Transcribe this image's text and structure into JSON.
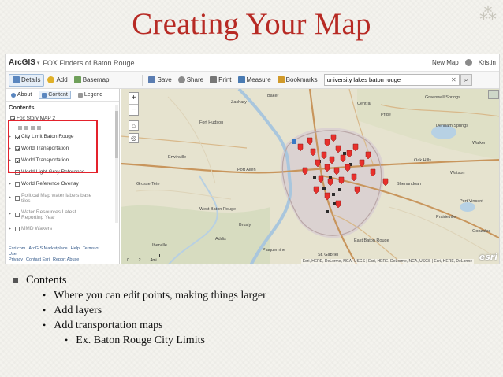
{
  "slide": {
    "title": "Creating Your Map",
    "ornament": "⁂"
  },
  "app": {
    "logo": "ArcGIS",
    "logo_caret": "▾",
    "title": "FOX Finders of Baton Rouge",
    "new_map": "New Map",
    "user": "Kristin"
  },
  "toolbar": {
    "details": "Details",
    "add": "Add",
    "basemap": "Basemap",
    "save": "Save",
    "share": "Share",
    "print": "Print",
    "measure": "Measure",
    "bookmarks": "Bookmarks",
    "search_value": "university lakes baton rouge",
    "clear": "✕",
    "search_icon": "⌕"
  },
  "sidebar": {
    "tabs": [
      {
        "label": "About"
      },
      {
        "label": "Content"
      },
      {
        "label": "Legend"
      }
    ],
    "contents_heading": "Contents",
    "layers": [
      {
        "label": "Fox Story MAP 2",
        "checked": true
      },
      {
        "label": "City Limit Baton Rouge",
        "checked": true
      },
      {
        "label": "World Transportation",
        "checked": true
      },
      {
        "label": "World Transportation",
        "checked": true
      },
      {
        "label": "World Light Gray Reference",
        "checked": false
      },
      {
        "label": "World Reference Overlay",
        "checked": false
      },
      {
        "label": "Political Map water labels base tiles",
        "checked": false
      },
      {
        "label": "Water Resources Latest Reporting Year",
        "checked": false
      },
      {
        "label": "MMD Wakers",
        "checked": false
      }
    ],
    "footer_links": [
      "Esri.com",
      "ArcGIS Marketplace",
      "Help",
      "Terms of Use",
      "Privacy",
      "Contact Esri",
      "Report Abuse"
    ]
  },
  "map": {
    "labels": {
      "zachary": "Zachary",
      "central": "Central",
      "denham": "Denham Springs",
      "walker": "Walker",
      "port_allen": "Port Allen",
      "brusly": "Brusly",
      "plaquemine": "Plaquemine",
      "gonzales": "Gonzales",
      "prairieville": "Prairieville",
      "st_gabriel": "St. Gabriel",
      "watson": "Watson",
      "shenandoah": "Shenandoah",
      "oak_hills": "Oak Hills",
      "west_baton_rouge": "West Baton Rouge",
      "east_baton_rouge": "East Baton Rouge",
      "pride": "Pride",
      "greenwell": "Greenwell Springs",
      "fort_hudson": "Fort Hudson",
      "grosse_tete": "Grosse Tete",
      "erwinville": "Erwinville",
      "addis": "Addis",
      "iberville": "Iberville",
      "port_vincent": "Port Vincent",
      "baker": "Baker"
    },
    "zoom_in": "+",
    "zoom_out": "−",
    "home_icon": "⌂",
    "locate_icon": "◎",
    "scale_labels": [
      "0",
      "2",
      "4mi"
    ],
    "attribution": "Esri, HERE, DeLorme, NGA, USGS | Esri, HERE, DeLorme, NGA, USGS | Esri, HERE, DeLorme",
    "esri_logo": "esri"
  },
  "bullets": {
    "level1": "Contents",
    "level2": [
      "Where you can edit points, making things larger",
      "Add layers",
      "Add transportation maps"
    ],
    "level3": "Ex. Baton Rouge City Limits"
  },
  "colors": {
    "title_red": "#b72a24",
    "highlight_red": "#e4222c",
    "pin_red": "#e8302c",
    "pin_dark": "#2b2b2b",
    "city_limits": "#b9a6a6"
  }
}
